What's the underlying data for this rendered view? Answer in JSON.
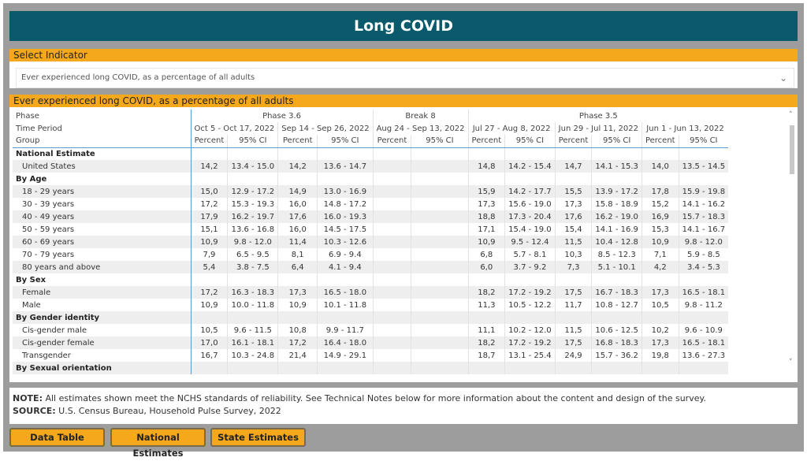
{
  "title": "Long COVID",
  "select_indicator": {
    "label": "Select Indicator",
    "value": "Ever experienced long COVID, as a percentage of all adults"
  },
  "table": {
    "title": "Ever experienced long COVID, as a percentage of all adults",
    "header_labels": [
      "Phase",
      "Time Period",
      "Group"
    ],
    "phases": [
      {
        "name": "Phase 3.6",
        "span": 2
      },
      {
        "name": "Break 8",
        "span": 1
      },
      {
        "name": "Phase 3.5",
        "span": 3
      }
    ],
    "periods": [
      "Oct 5 - Oct 17, 2022",
      "Sep 14 - Sep 26, 2022",
      "Aug 24 - Sep 13, 2022",
      "Jul 27 - Aug 8, 2022",
      "Jun 29 - Jul 11, 2022",
      "Jun 1 - Jun 13, 2022"
    ],
    "subcols": [
      "Percent",
      "95% CI"
    ],
    "rows": [
      {
        "label": "National Estimate",
        "group": true
      },
      {
        "label": "United States",
        "values": [
          "14,2",
          "13.4 - 15.0",
          "14,2",
          "13.6 - 14.7",
          "",
          "",
          "14,8",
          "14.2 - 15.4",
          "14,7",
          "14.1 - 15.3",
          "14,0",
          "13.5 - 14.5"
        ]
      },
      {
        "label": "By Age",
        "group": true
      },
      {
        "label": "18 - 29 years",
        "values": [
          "15,0",
          "12.9 - 17.2",
          "14,9",
          "13.0 - 16.9",
          "",
          "",
          "15,9",
          "14.2 - 17.7",
          "15,5",
          "13.9 - 17.2",
          "17,8",
          "15.9 - 19.8"
        ]
      },
      {
        "label": "30 - 39 years",
        "values": [
          "17,2",
          "15.3 - 19.3",
          "16,0",
          "14.8 - 17.2",
          "",
          "",
          "17,3",
          "15.6 - 19.0",
          "17,3",
          "15.8 - 18.9",
          "15,2",
          "14.1 - 16.2"
        ]
      },
      {
        "label": "40 - 49 years",
        "values": [
          "17,9",
          "16.2 - 19.7",
          "17,6",
          "16.0 - 19.3",
          "",
          "",
          "18,8",
          "17.3 - 20.4",
          "17,6",
          "16.2 - 19.0",
          "16,9",
          "15.7 - 18.3"
        ]
      },
      {
        "label": "50 - 59 years",
        "values": [
          "15,1",
          "13.6 - 16.8",
          "16,0",
          "14.5 - 17.5",
          "",
          "",
          "17,1",
          "15.4 - 19.0",
          "15,4",
          "14.1 - 16.9",
          "15,3",
          "14.1 - 16.7"
        ]
      },
      {
        "label": "60 - 69 years",
        "values": [
          "10,9",
          "9.8 - 12.0",
          "11,4",
          "10.3 - 12.6",
          "",
          "",
          "10,9",
          "9.5 - 12.4",
          "11,5",
          "10.4 - 12.8",
          "10,9",
          "9.8 - 12.0"
        ]
      },
      {
        "label": "70 - 79 years",
        "values": [
          "7,9",
          "6.5 - 9.5",
          "8,1",
          "6.9 - 9.4",
          "",
          "",
          "6,8",
          "5.7 - 8.1",
          "10,3",
          "8.5 - 12.3",
          "7,1",
          "5.9 - 8.5"
        ]
      },
      {
        "label": "80 years and above",
        "values": [
          "5,4",
          "3.8 - 7.5",
          "6,4",
          "4.1 - 9.4",
          "",
          "",
          "6,0",
          "3.7 - 9.2",
          "7,3",
          "5.1 - 10.1",
          "4,2",
          "3.4 - 5.3"
        ]
      },
      {
        "label": "By Sex",
        "group": true
      },
      {
        "label": "Female",
        "values": [
          "17,2",
          "16.3 - 18.3",
          "17,3",
          "16.5 - 18.0",
          "",
          "",
          "18,2",
          "17.2 - 19.2",
          "17,5",
          "16.7 - 18.3",
          "17,3",
          "16.5 - 18.1"
        ]
      },
      {
        "label": "Male",
        "values": [
          "10,9",
          "10.0 - 11.8",
          "10,9",
          "10.1 - 11.8",
          "",
          "",
          "11,3",
          "10.5 - 12.2",
          "11,7",
          "10.8 - 12.7",
          "10,5",
          "9.8 - 11.2"
        ]
      },
      {
        "label": "By Gender identity",
        "group": true
      },
      {
        "label": "Cis-gender male",
        "values": [
          "10,5",
          "9.6 - 11.5",
          "10,8",
          "9.9 - 11.7",
          "",
          "",
          "11,1",
          "10.2 - 12.0",
          "11,5",
          "10.6 - 12.5",
          "10,2",
          "9.6 - 10.9"
        ]
      },
      {
        "label": "Cis-gender female",
        "values": [
          "17,0",
          "16.1 - 18.1",
          "17,2",
          "16.4 - 18.0",
          "",
          "",
          "18,2",
          "17.2 - 19.2",
          "17,5",
          "16.8 - 18.3",
          "17,3",
          "16.5 - 18.1"
        ]
      },
      {
        "label": "Transgender",
        "values": [
          "16,7",
          "10.3 - 24.8",
          "21,4",
          "14.9 - 29.1",
          "",
          "",
          "18,7",
          "13.1 - 25.4",
          "24,9",
          "15.7 - 36.2",
          "19,8",
          "13.6 - 27.3"
        ]
      },
      {
        "label": "By Sexual orientation",
        "group": true
      }
    ]
  },
  "note": {
    "note_label": "NOTE:",
    "note_text": " All estimates shown meet the NCHS standards of reliability. See Technical Notes below for more information about the content and design of the survey.",
    "source_label": "SOURCE:",
    "source_text": " U.S. Census Bureau, Household Pulse Survey, 2022"
  },
  "buttons": [
    "Data Table",
    "National Estimates",
    "State Estimates"
  ],
  "colors": {
    "title_bar": "#0b5a6b",
    "accent": "#f5a81c"
  }
}
